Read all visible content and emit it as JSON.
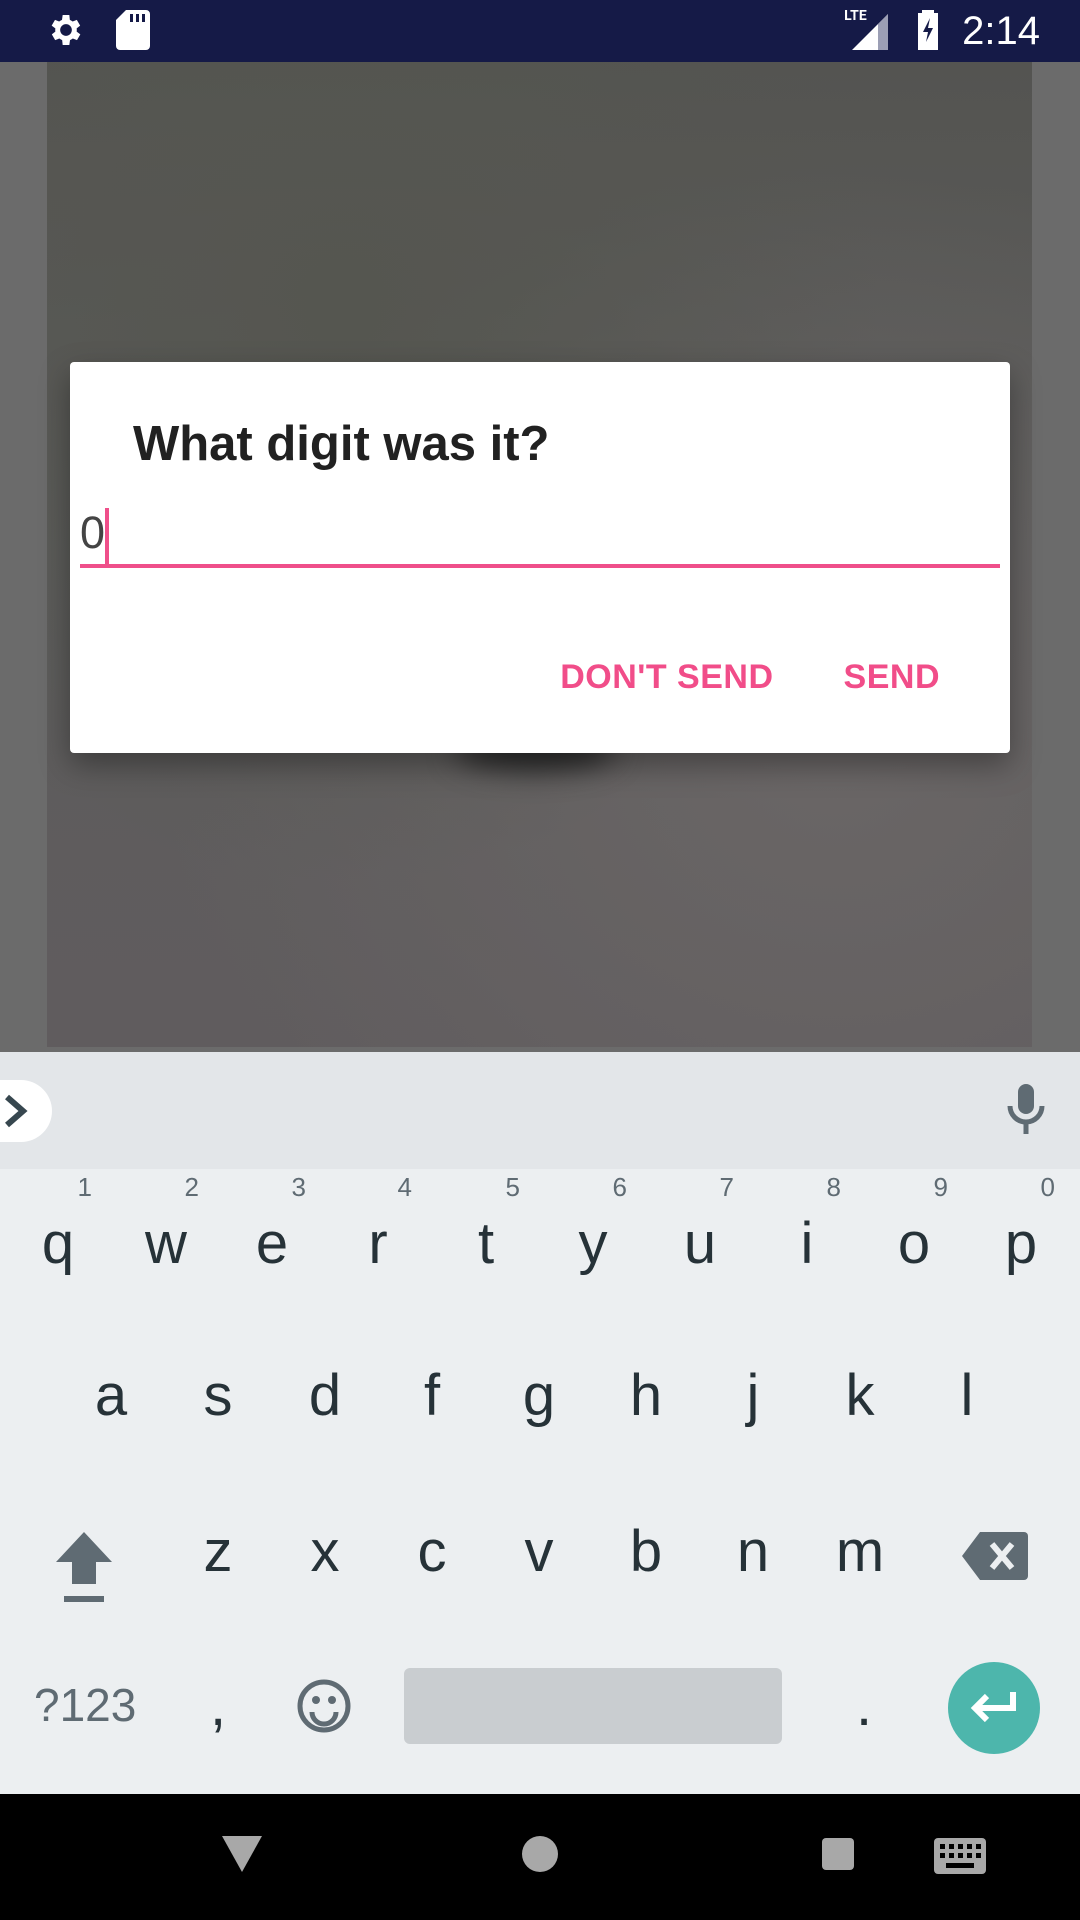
{
  "status_bar": {
    "time": "2:14",
    "network_label": "LTE",
    "icons": [
      "gear-icon",
      "sd-card-icon",
      "lte-signal-icon",
      "battery-charging-icon"
    ]
  },
  "dialog": {
    "title": "What digit was it?",
    "input_value": "0",
    "dont_send_label": "DON'T SEND",
    "send_label": "SEND",
    "accent_color": "#f14d89"
  },
  "keyboard": {
    "row1": [
      {
        "k": "q",
        "h": "1"
      },
      {
        "k": "w",
        "h": "2"
      },
      {
        "k": "e",
        "h": "3"
      },
      {
        "k": "r",
        "h": "4"
      },
      {
        "k": "t",
        "h": "5"
      },
      {
        "k": "y",
        "h": "6"
      },
      {
        "k": "u",
        "h": "7"
      },
      {
        "k": "i",
        "h": "8"
      },
      {
        "k": "o",
        "h": "9"
      },
      {
        "k": "p",
        "h": "0"
      }
    ],
    "row2": [
      "a",
      "s",
      "d",
      "f",
      "g",
      "h",
      "j",
      "k",
      "l"
    ],
    "row3": [
      "z",
      "x",
      "c",
      "v",
      "b",
      "n",
      "m"
    ],
    "symbols_label": "?123",
    "comma": ",",
    "period": ".",
    "enter_color": "#4db6ac"
  },
  "nav_bar": {
    "icons": [
      "back-icon",
      "home-icon",
      "recents-icon",
      "keyboard-switch-icon"
    ]
  }
}
